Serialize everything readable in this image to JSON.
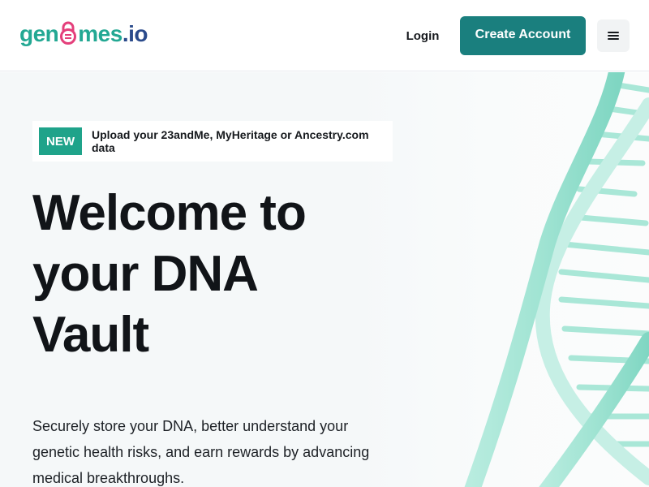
{
  "header": {
    "logo": {
      "part1": "gen",
      "part2": "mes",
      "tld": ".io"
    },
    "login_label": "Login",
    "create_account_label": "Create Account",
    "menu_icon": "hamburger-menu-icon"
  },
  "hero": {
    "banner": {
      "badge": "NEW",
      "text": "Upload your 23andMe, MyHeritage or Ancestry.com data"
    },
    "title_line1": "Welcome to",
    "title_line2": "your DNA",
    "title_line3": "Vault",
    "subtitle": "Securely store your DNA, better understand your genetic health risks, and earn rewards by advancing medical breakthroughs."
  },
  "colors": {
    "brand_teal": "#23a893",
    "brand_navy": "#2a4a8b",
    "primary_button": "#1a7f7e",
    "badge": "#1fa38a",
    "helix": "#9fe3d2"
  }
}
